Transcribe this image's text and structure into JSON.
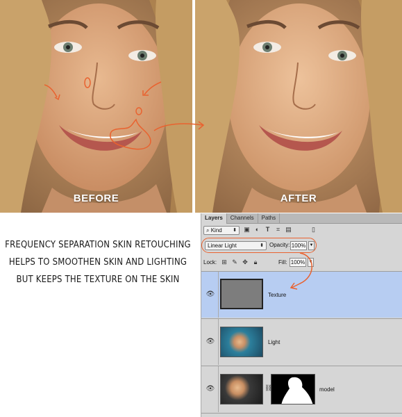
{
  "labels": {
    "before": "BEFORE",
    "after": "AFTER"
  },
  "caption": {
    "line1": "Frequency separation skin retouching",
    "line2": "helps to smoothen skin and lighting",
    "line3": "but keeps the texture on the skin"
  },
  "panel": {
    "tabs": [
      "Layers",
      "Channels",
      "Paths"
    ],
    "kind_label": "⌕ Kind",
    "blend_mode": "Linear Light",
    "opacity_label": "Opacity:",
    "opacity_value": "100%",
    "lock_label": "Lock:",
    "fill_label": "Fill:",
    "fill_value": "100%",
    "layers": [
      {
        "name": "Texture",
        "selected": true
      },
      {
        "name": "Light",
        "selected": false
      },
      {
        "name": "model",
        "selected": false
      }
    ]
  },
  "colors": {
    "annotation": "#e9622f",
    "selected_layer": "#b7cdf2",
    "panel_bg": "#d6d6d6"
  }
}
